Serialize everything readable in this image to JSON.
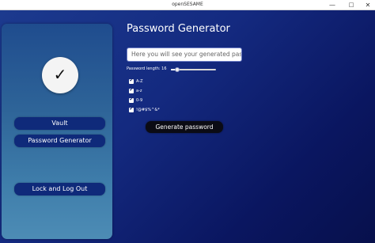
{
  "window": {
    "title": "openSESAME",
    "minimize_glyph": "—",
    "maximize_glyph": "□",
    "close_glyph": "✕"
  },
  "sidebar": {
    "avatar_glyph": "✓",
    "vault_label": "Vault",
    "password_generator_label": "Password Generator",
    "lock_logout_label": "Lock and Log Out"
  },
  "main": {
    "page_title": "Password Generator",
    "password_field": {
      "value": "",
      "placeholder": "Here you will see your generated password"
    },
    "length": {
      "label": "Password length: 16",
      "value": 16,
      "min": 8,
      "max": 64
    },
    "options": [
      {
        "label": "A-Z",
        "checked": true
      },
      {
        "label": "a-z",
        "checked": true
      },
      {
        "label": "0-9",
        "checked": true
      },
      {
        "label": "!@#$%^&*",
        "checked": true
      }
    ],
    "check_glyph": "✔",
    "generate_label": "Generate password"
  },
  "colors": {
    "background_dark": "#0d1a5c",
    "nav_button": "#0f2a7a",
    "generate_button": "#0b0b14",
    "sidebar_top": "#1f4c8e",
    "sidebar_bottom": "#4d8cb5"
  }
}
